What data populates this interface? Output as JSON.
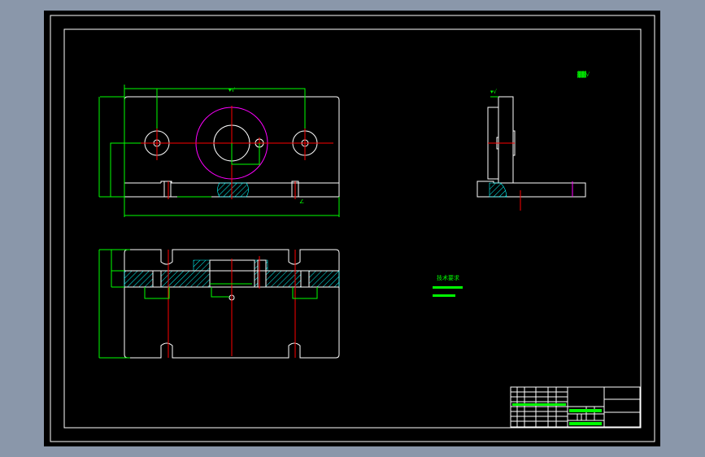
{
  "canvas": {
    "background": "#000000",
    "window_background": "#8a97aa"
  },
  "colors": {
    "outline": "#ffffff",
    "dimension": "#00ff00",
    "centerline": "#ff0000",
    "hidden_circle": "#ff00ff",
    "hatch": "#00ffff"
  },
  "notes": {
    "title": "技术要求"
  }
}
